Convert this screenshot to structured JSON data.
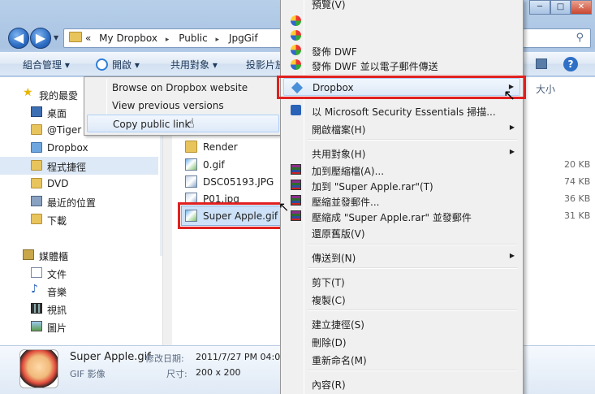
{
  "address_bar": {
    "back_glyph": "◀",
    "forward_glyph": "▶",
    "crumbs": [
      "«",
      "My Dropbox",
      "Public",
      "JpgGif"
    ],
    "separator": "▸"
  },
  "toolbar": {
    "organize": "組合管理 ▾",
    "open": "開啟 ▾",
    "share": "共用對象 ▾",
    "burn": "投影片放",
    "help": "?"
  },
  "window_controls": {
    "min": "─",
    "max": "□",
    "close": "✕"
  },
  "nav_pane": {
    "items": [
      {
        "label": "我的最愛"
      },
      {
        "label": "桌面"
      },
      {
        "label": "@Tiger"
      },
      {
        "label": "Dropbox"
      },
      {
        "label": "程式捷徑"
      },
      {
        "label": "DVD"
      },
      {
        "label": "最近的位置"
      },
      {
        "label": "下載"
      },
      {
        "label": "媒體櫃"
      },
      {
        "label": "文件"
      },
      {
        "label": "音樂"
      },
      {
        "label": "視訊"
      },
      {
        "label": "圖片"
      }
    ]
  },
  "file_list": {
    "size_header": "大小",
    "items": [
      {
        "name": "Render",
        "size": ""
      },
      {
        "name": "0.gif",
        "size": "20 KB"
      },
      {
        "name": "DSC05193.JPG",
        "size": "74 KB"
      },
      {
        "name": "P01.jpg",
        "size": "36 KB"
      },
      {
        "name": "Super Apple.gif",
        "size": "31 KB"
      }
    ]
  },
  "details": {
    "name": "Super Apple.gif",
    "type": "GIF 影像",
    "modified_label": "修改日期:",
    "modified_value": "2011/7/27 PM 04:0",
    "size_label": "尺寸:",
    "size_value": "200 x 200"
  },
  "dropbox_submenu": {
    "items": [
      {
        "label": "Browse on Dropbox website"
      },
      {
        "label": "View previous versions"
      },
      {
        "label": "Copy public link"
      }
    ]
  },
  "context_menu": {
    "top_cut": "預覽(V)",
    "items": [
      {
        "label": "發佈 DWF",
        "icon": "dwf-icon"
      },
      {
        "label": "發佈 DWF 並以電子郵件傳送",
        "icon": "dwf-icon"
      },
      {
        "label": "Dropbox",
        "icon": "dropbox-icon",
        "submenu": true
      },
      {
        "label": "以 Microsoft Security Essentials 掃描...",
        "icon": "security-essentials-icon"
      },
      {
        "label": "開啟檔案(H)",
        "submenu": true
      },
      {
        "label": "共用對象(H)",
        "submenu": true
      },
      {
        "label": "加到壓縮檔(A)...",
        "icon": "winrar-icon"
      },
      {
        "label": "加到 \"Super Apple.rar\"(T)",
        "icon": "winrar-icon"
      },
      {
        "label": "壓縮並發郵件...",
        "icon": "winrar-icon"
      },
      {
        "label": "壓縮成 \"Super Apple.rar\" 並發郵件",
        "icon": "winrar-icon"
      },
      {
        "label": "還原舊版(V)"
      },
      {
        "label": "傳送到(N)",
        "submenu": true
      },
      {
        "label": "剪下(T)"
      },
      {
        "label": "複製(C)"
      },
      {
        "label": "建立捷徑(S)"
      },
      {
        "label": "刪除(D)"
      },
      {
        "label": "重新命名(M)"
      },
      {
        "label": "內容(R)"
      }
    ]
  },
  "colors": {
    "highlight_box": "#e02020",
    "menu_hover": "#dde9f8",
    "menu_bg": "#f0f0f0"
  }
}
